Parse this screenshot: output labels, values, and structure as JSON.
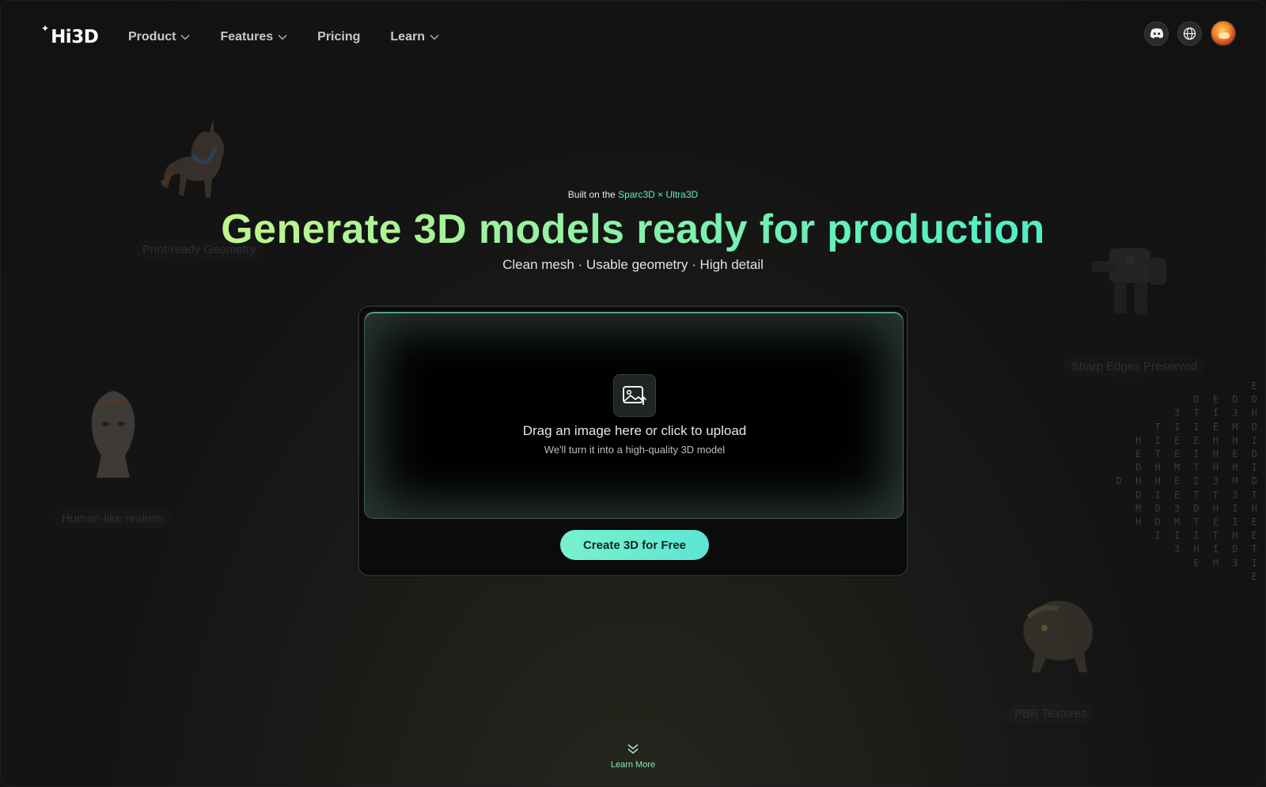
{
  "header": {
    "logo": "Hi3D",
    "nav": [
      {
        "label": "Product",
        "has_dropdown": true
      },
      {
        "label": "Features",
        "has_dropdown": true
      },
      {
        "label": "Pricing",
        "has_dropdown": false
      },
      {
        "label": "Learn",
        "has_dropdown": true
      }
    ],
    "icons": [
      "discord-icon",
      "globe-icon"
    ]
  },
  "hero": {
    "eyebrow_prefix": "Built on the ",
    "eyebrow_accent": "Sparc3D × Ultra3D",
    "headline": "Generate 3D models ready for production",
    "subline": "Clean mesh · Usable geometry · High detail"
  },
  "upload": {
    "title": "Drag an image here or click to upload",
    "subtitle": "We'll turn it into a high-quality 3D model",
    "cta": "Create 3D for Free"
  },
  "decor": {
    "labels": [
      "Print-ready Geometry",
      "Sharp Edges Preserved",
      "Human-like realism",
      "PBR Textures"
    ],
    "matrix_lines": [
      "E",
      "D E D D",
      "3 T I 3 H",
      "T I I E M D",
      "H I E E H H I",
      "E T E I H E D",
      "D H M T H H I",
      "D H H E I 3 M D",
      "D I E T T 3 T",
      "M D 3 D H I H",
      "H D M T E I E",
      "I I I T H E",
      "3 H I D T",
      "E M 3 I",
      "E"
    ]
  },
  "footer": {
    "learn_more": "Learn More"
  },
  "colors": {
    "accent": "#5ff0c0",
    "cta": "#6eeccf",
    "background": "#131313"
  }
}
